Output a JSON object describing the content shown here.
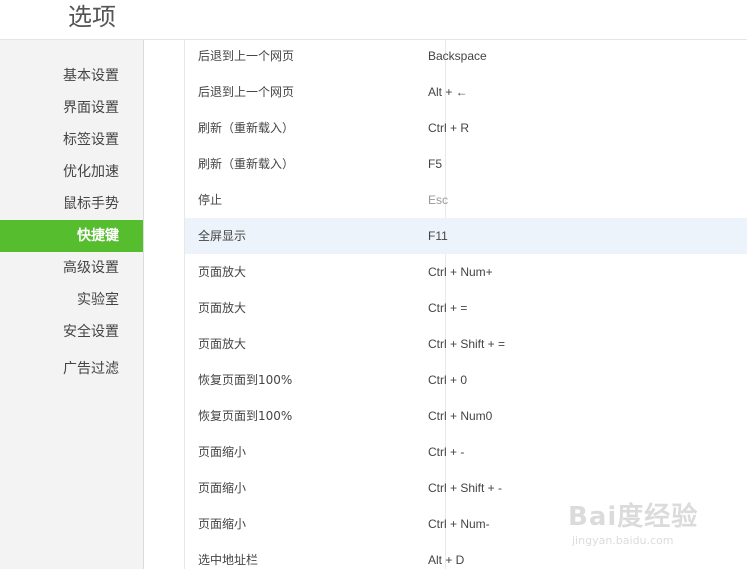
{
  "page_title": "选项",
  "sidebar": {
    "items": [
      {
        "label": "基本设置",
        "active": false
      },
      {
        "label": "界面设置",
        "active": false
      },
      {
        "label": "标签设置",
        "active": false
      },
      {
        "label": "优化加速",
        "active": false
      },
      {
        "label": "鼠标手势",
        "active": false
      },
      {
        "label": "快捷键",
        "active": true
      },
      {
        "label": "高级设置",
        "active": false
      },
      {
        "label": "实验室",
        "active": false
      },
      {
        "label": "安全设置",
        "active": false
      },
      {
        "label": "广告过滤",
        "active": false
      }
    ]
  },
  "shortcuts": {
    "rows": [
      {
        "action": "后退到上一个网页",
        "key": "Backspace"
      },
      {
        "action": "后退到上一个网页",
        "key": "Alt + ←"
      },
      {
        "action": "刷新（重新载入）",
        "key": "Ctrl + R"
      },
      {
        "action": "刷新（重新载入）",
        "key": "F5"
      },
      {
        "action": "停止",
        "key": "Esc"
      },
      {
        "action": "全屏显示",
        "key": "F11"
      },
      {
        "action": "页面放大",
        "key": "Ctrl + Num+"
      },
      {
        "action": "页面放大",
        "key": "Ctrl + ="
      },
      {
        "action": "页面放大",
        "key": "Ctrl + Shift + ="
      },
      {
        "action": "恢复页面到100%",
        "key": "Ctrl + 0"
      },
      {
        "action": "恢复页面到100%",
        "key": "Ctrl + Num0"
      },
      {
        "action": "页面缩小",
        "key": "Ctrl + -"
      },
      {
        "action": "页面缩小",
        "key": "Ctrl + Shift + -"
      },
      {
        "action": "页面缩小",
        "key": "Ctrl + Num-"
      },
      {
        "action": "选中地址栏",
        "key": "Alt + D"
      }
    ]
  },
  "watermark": {
    "main": "Bai度经验",
    "sub": "jingyan.baidu.com"
  },
  "colors": {
    "accent": "#56bd2f",
    "row_highlight": "#edf3fa",
    "sidebar_bg": "#f3f3f3"
  }
}
